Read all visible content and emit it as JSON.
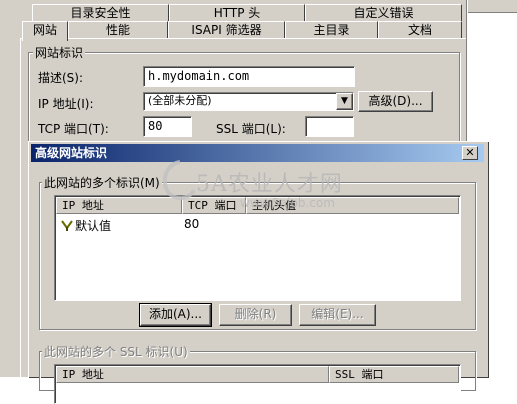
{
  "tabs_back": [
    "目录安全性",
    "HTTP 头",
    "自定义错误"
  ],
  "tabs_front": [
    "网站",
    "性能",
    "ISAPI 筛选器",
    "主目录",
    "文档"
  ],
  "website_id": {
    "group_title": "网站标识",
    "description_label": "描述(S):",
    "description_value": "h.mydomain.com",
    "ip_label": "IP 地址(I):",
    "ip_value": "(全部未分配)",
    "advanced_button": "高级(D)...",
    "tcp_label": "TCP 端口(T):",
    "tcp_value": "80",
    "ssl_label": "SSL 端口(L):",
    "ssl_value": ""
  },
  "advanced_dialog": {
    "title": "高级网站标识",
    "close_glyph": "✕",
    "multi_id_title": "此网站的多个标识(M)",
    "columns": [
      "IP 地址",
      "TCP 端口",
      "主机头值"
    ],
    "rows": [
      {
        "ip": "默认值",
        "tcp": "80",
        "host": ""
      }
    ],
    "add_button": "添加(A)...",
    "delete_button": "删除(R)",
    "edit_button": "编辑(E)...",
    "ssl_title": "此网站的多个 SSL 标识(U)",
    "ssl_columns": [
      "IP 地址",
      "SSL 端口"
    ]
  },
  "watermark": {
    "text_cn": "5A农业人才网",
    "text_url": "www.5ajob.com"
  },
  "icons": {
    "row_icon": "network-card-icon",
    "dropdown": "chevron-down-icon"
  }
}
